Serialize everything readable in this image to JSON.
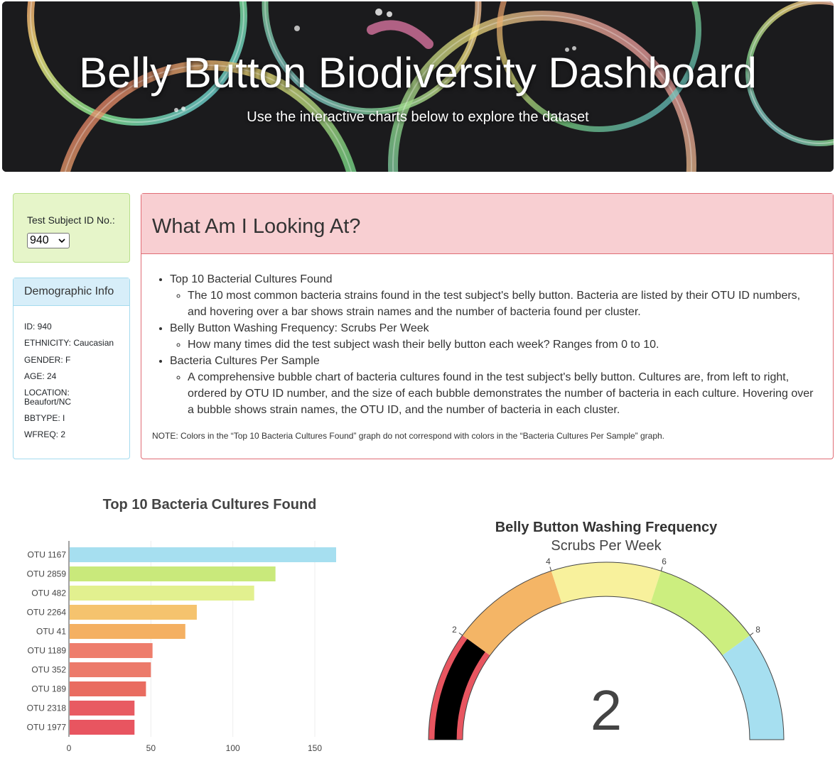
{
  "header": {
    "title": "Belly Button Biodiversity Dashboard",
    "subtitle": "Use the interactive charts below to explore the dataset"
  },
  "selector": {
    "label": "Test Subject ID No.:",
    "selected": "940"
  },
  "demographics": {
    "title": "Demographic Info",
    "rows": [
      "ID: 940",
      "ETHNICITY: Caucasian",
      "GENDER: F",
      "AGE: 24",
      "LOCATION:",
      "Beaufort/NC",
      "BBTYPE: I",
      "WFREQ: 2"
    ]
  },
  "info": {
    "title": "What Am I Looking At?",
    "items": [
      {
        "heading": "Top 10 Bacterial Cultures Found",
        "detail": "The 10 most common bacteria strains found in the test subject's belly button. Bacteria are listed by their OTU ID numbers, and hovering over a bar shows strain names and the number of bacteria found per cluster."
      },
      {
        "heading": "Belly Button Washing Frequency: Scrubs Per Week",
        "detail": "How many times did the test subject wash their belly button each week? Ranges from 0 to 10."
      },
      {
        "heading": "Bacteria Cultures Per Sample",
        "detail": "A comprehensive bubble chart of bacteria cultures found in the test subject's belly button. Cultures are, from left to right, ordered by OTU ID number, and the size of each bubble demonstrates the number of bacteria in each culture. Hovering over a bubble shows strain names, the OTU ID, and the number of bacteria in each cluster."
      }
    ],
    "note": "NOTE: Colors in the “Top 10 Bacteria Cultures Found” graph do not correspond with colors in the “Bacteria Cultures Per Sample” graph."
  },
  "chart_data": [
    {
      "type": "bar",
      "orientation": "horizontal",
      "title": "Top 10 Bacteria Cultures Found",
      "categories": [
        "OTU 1167",
        "OTU 2859",
        "OTU 482",
        "OTU 2264",
        "OTU 41",
        "OTU 1189",
        "OTU 352",
        "OTU 189",
        "OTU 2318",
        "OTU 1977"
      ],
      "values": [
        163,
        126,
        113,
        78,
        71,
        51,
        50,
        47,
        40,
        40
      ],
      "colors": [
        "#a6dff0",
        "#c9e97b",
        "#e2f08f",
        "#f5c36e",
        "#f4b062",
        "#ee7d6c",
        "#ec7a6a",
        "#e96c60",
        "#e85b62",
        "#e85560"
      ],
      "xticks": [
        0,
        50,
        100,
        150
      ],
      "xlim": [
        0,
        163
      ],
      "grid": true
    },
    {
      "type": "gauge",
      "title": "Belly Button Washing Frequency",
      "subtitle": "Scrubs Per Week",
      "value": 2,
      "range": [
        0,
        10
      ],
      "ticks": [
        2,
        4,
        6,
        8
      ],
      "bands": [
        {
          "from": 0,
          "to": 2,
          "color": "#e85560"
        },
        {
          "from": 2,
          "to": 4,
          "color": "#f4b566"
        },
        {
          "from": 4,
          "to": 6,
          "color": "#f8f19c"
        },
        {
          "from": 6,
          "to": 8,
          "color": "#ccee7f"
        },
        {
          "from": 8,
          "to": 10,
          "color": "#a6dff0"
        }
      ],
      "bar_color": "#000000"
    }
  ]
}
